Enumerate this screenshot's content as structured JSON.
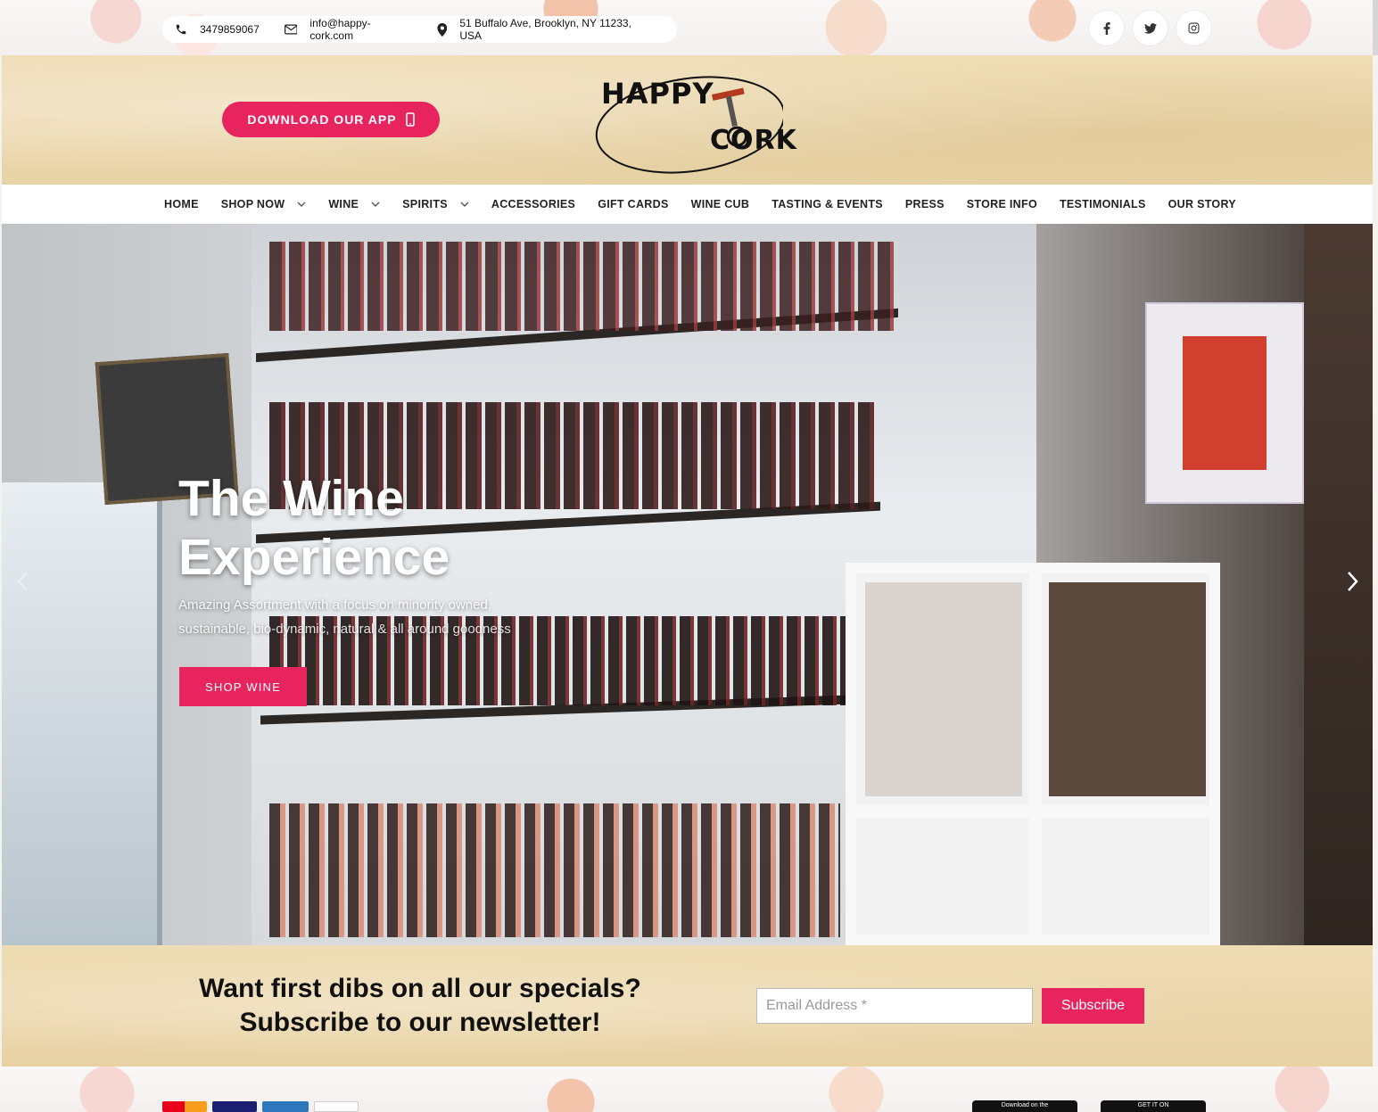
{
  "topbar": {
    "phone": "3479859067",
    "email": "info@happy-cork.com",
    "address": "51 Buffalo Ave, Brooklyn, NY 11233, USA",
    "socials": [
      "facebook-icon",
      "twitter-icon",
      "instagram-icon"
    ]
  },
  "header": {
    "app_button": "DOWNLOAD OUR APP",
    "logo_top": "HAPPY",
    "logo_bottom": "CORK"
  },
  "nav": {
    "items": [
      {
        "label": "HOME",
        "dropdown": false
      },
      {
        "label": "SHOP NOW",
        "dropdown": true
      },
      {
        "label": "WINE",
        "dropdown": true
      },
      {
        "label": "SPIRITS",
        "dropdown": true
      },
      {
        "label": "ACCESSORIES",
        "dropdown": false
      },
      {
        "label": "GIFT CARDS",
        "dropdown": false
      },
      {
        "label": "WINE CUB",
        "dropdown": false
      },
      {
        "label": "TASTING & EVENTS",
        "dropdown": false
      },
      {
        "label": "PRESS",
        "dropdown": false
      },
      {
        "label": "STORE INFO",
        "dropdown": false
      },
      {
        "label": "TESTIMONIALS",
        "dropdown": false
      },
      {
        "label": "OUR STORY",
        "dropdown": false
      }
    ]
  },
  "hero": {
    "title_line1": "The Wine",
    "title_line2": "Experience",
    "subtitle_line1": "Amazing Assortment with a focus on minority owned,",
    "subtitle_line2": "sustainable, bio-dynamic, natural & all around goodness",
    "cta": "SHOP WINE"
  },
  "newsletter": {
    "line1": "Want first dibs on all our specials?",
    "line2": "Subscribe to our newsletter!",
    "placeholder": "Email Address *",
    "button": "Subscribe"
  },
  "footer": {
    "badges": [
      "Download on the",
      "GET IT ON"
    ],
    "cards": [
      "mastercard",
      "visa",
      "american-express",
      "discover"
    ]
  },
  "colors": {
    "accent": "#e8245f",
    "parchment": "#eedcb4"
  }
}
